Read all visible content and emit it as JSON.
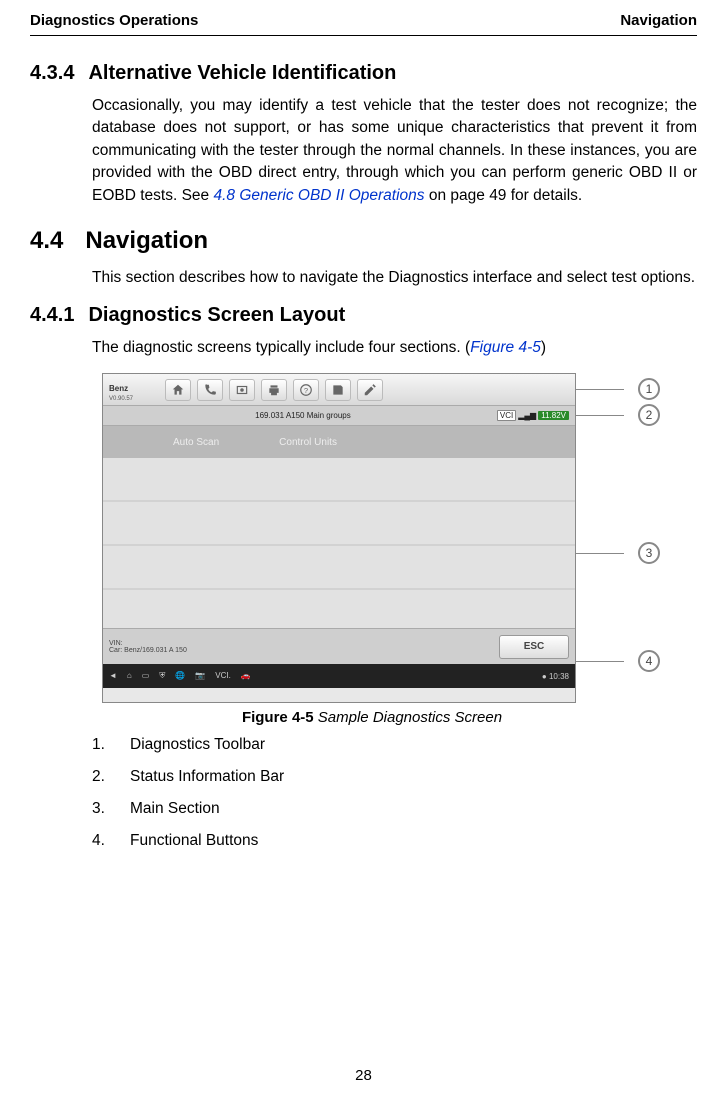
{
  "header": {
    "left": "Diagnostics Operations",
    "right": "Navigation"
  },
  "s434": {
    "num": "4.3.4",
    "title": "Alternative Vehicle Identification",
    "p1a": "Occasionally, you may identify a test vehicle that the tester does not recognize; the database does not support, or has some unique characteristics that prevent it from communicating with the tester through the normal channels. In these instances, you are provided with the OBD direct entry, through which you can perform generic OBD II or EOBD tests. See ",
    "p1link": "4.8 Generic OBD II Operations",
    "p1b": " on page 49 for details."
  },
  "s44": {
    "num": "4.4",
    "title": "Navigation",
    "p": "This section describes how to navigate the Diagnostics interface and select test options."
  },
  "s441": {
    "num": "4.4.1",
    "title": "Diagnostics Screen Layout",
    "p_a": "The diagnostic screens typically include four sections. (",
    "p_link": "Figure 4-5",
    "p_b": ")"
  },
  "figure": {
    "brand": "Benz",
    "version": "V0.90.57",
    "status_center": "169.031 A150 Main groups",
    "vci": "VCI",
    "volt": "11.82V",
    "tab1": "Auto Scan",
    "tab2": "Control Units",
    "vin_label": "VIN:",
    "car_label": "Car: Benz/169.031 A 150",
    "esc": "ESC",
    "clock": "10:38",
    "c1": "1",
    "c2": "2",
    "c3": "3",
    "c4": "4"
  },
  "caption": {
    "bold": "Figure 4-5",
    "italic": " Sample Diagnostics Screen"
  },
  "list": [
    {
      "n": "1.",
      "t": "Diagnostics Toolbar"
    },
    {
      "n": "2.",
      "t": "Status Information Bar"
    },
    {
      "n": "3.",
      "t": "Main Section"
    },
    {
      "n": "4.",
      "t": "Functional Buttons"
    }
  ],
  "page": "28"
}
